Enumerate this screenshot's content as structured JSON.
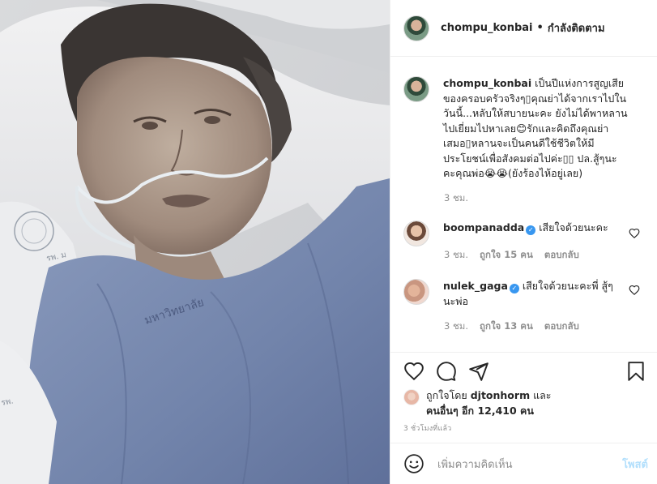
{
  "header": {
    "username": "chompu_konbai",
    "separator": "•",
    "follow_status": "กำลังติดตาม"
  },
  "caption": {
    "username": "chompu_konbai",
    "lines": [
      "เป็นปีแห่งการสูญเสีย",
      "ของครอบครัวจริงๆ▯คุณย่าได้จากเราไปใน",
      "วันนี้...หลับให้สบายนะคะ ยังไม่ได้พาหลาน",
      "ไปเยี่ยมไปหาเลย😊รักและคิดถึงคุณย่า",
      "เสมอ▯หลานจะเป็นคนดีใช้ชีวิตให้มี",
      "ประโยชน์เพื่อสังคมต่อไปค่ะ▯▯ ปล.สู้ๆนะ",
      "คะคุณพ่อ😭😭(ยังร้องไห้อยู่เลย)"
    ],
    "time": "3 ชม."
  },
  "comments": [
    {
      "username": "boompanadda",
      "verified_mark": "✓",
      "lines": [
        "เสียใจด้วยนะคะ"
      ],
      "time": "3 ชม.",
      "likes": "ถูกใจ 15 คน",
      "reply": "ตอบกลับ"
    },
    {
      "username": "nulek_gaga",
      "verified_mark": "✓",
      "lines": [
        "เสียใจด้วยนะคะพี่ สู้ๆ",
        "นะพ่อ"
      ],
      "time": "3 ชม.",
      "likes": "ถูกใจ 13 คน",
      "reply": "ตอบกลับ"
    }
  ],
  "likes_summary": {
    "prefix": "ถูกใจโดย",
    "liker": "djtonhorm",
    "conjunction": "และ",
    "others": "คนอื่นๆ อีก 12,410 คน"
  },
  "post_time": "3 ชั่วโมงที่แล้ว",
  "composer": {
    "placeholder": "เพิ่มความคิดเห็น",
    "post_label": "โพสต์"
  },
  "icons": {
    "like": "heart-icon",
    "comment": "comment-icon",
    "share": "share-icon",
    "save": "bookmark-icon",
    "emoji": "emoji-icon"
  },
  "colors": {
    "border": "#efefef",
    "muted_text": "#8e8e8e",
    "verified_blue": "#3897f0",
    "post_button_disabled": "#b2dffc",
    "gown_blue": "#7d8fb4"
  }
}
